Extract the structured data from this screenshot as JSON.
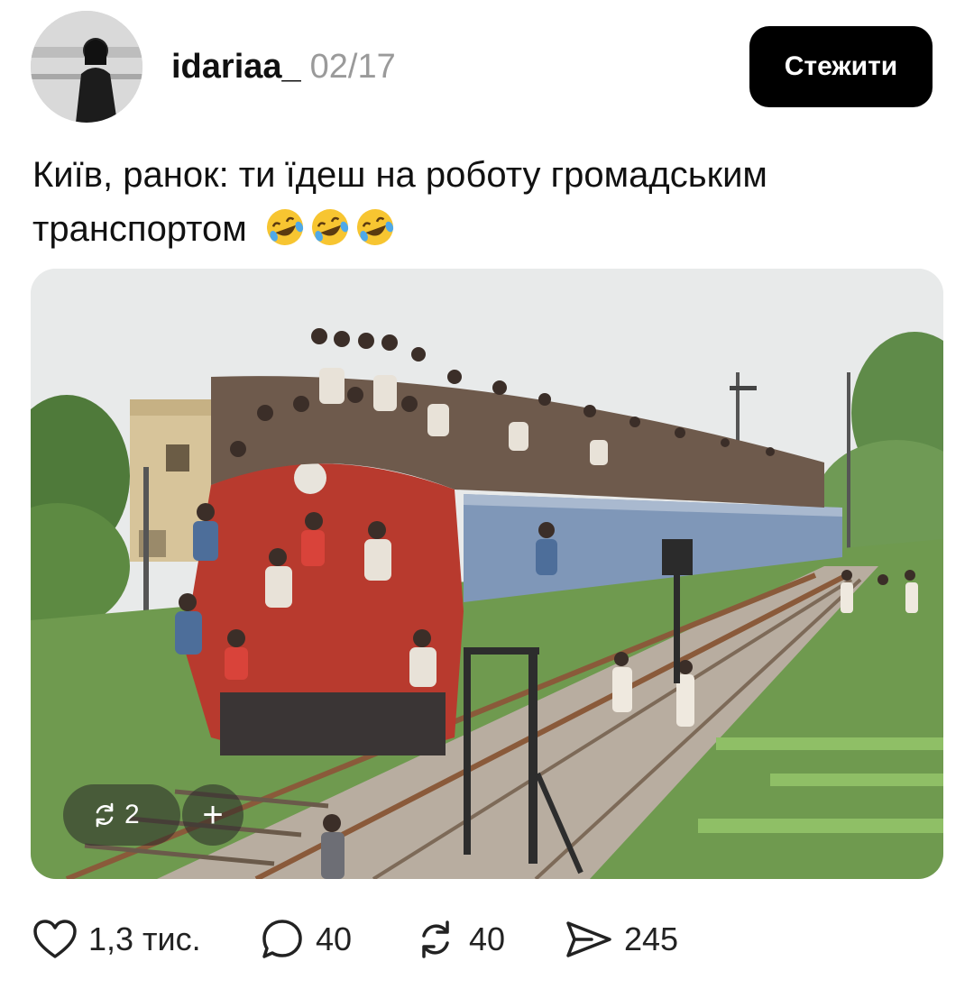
{
  "post": {
    "author": "idariaa_",
    "date": "02/17",
    "follow_label": "Стежити",
    "text": "Київ, ранок: ти їдеш на роботу громадським транспортом",
    "emoji": [
      "rolling-on-floor-laughing",
      "rolling-on-floor-laughing",
      "rolling-on-floor-laughing"
    ]
  },
  "media": {
    "repost_count": "2",
    "plus_label": "+"
  },
  "actions": {
    "likes": "1,3 тис.",
    "comments": "40",
    "reposts": "40",
    "shares": "245"
  },
  "colors": {
    "accent": "#000000",
    "date": "#9a9a9a"
  }
}
